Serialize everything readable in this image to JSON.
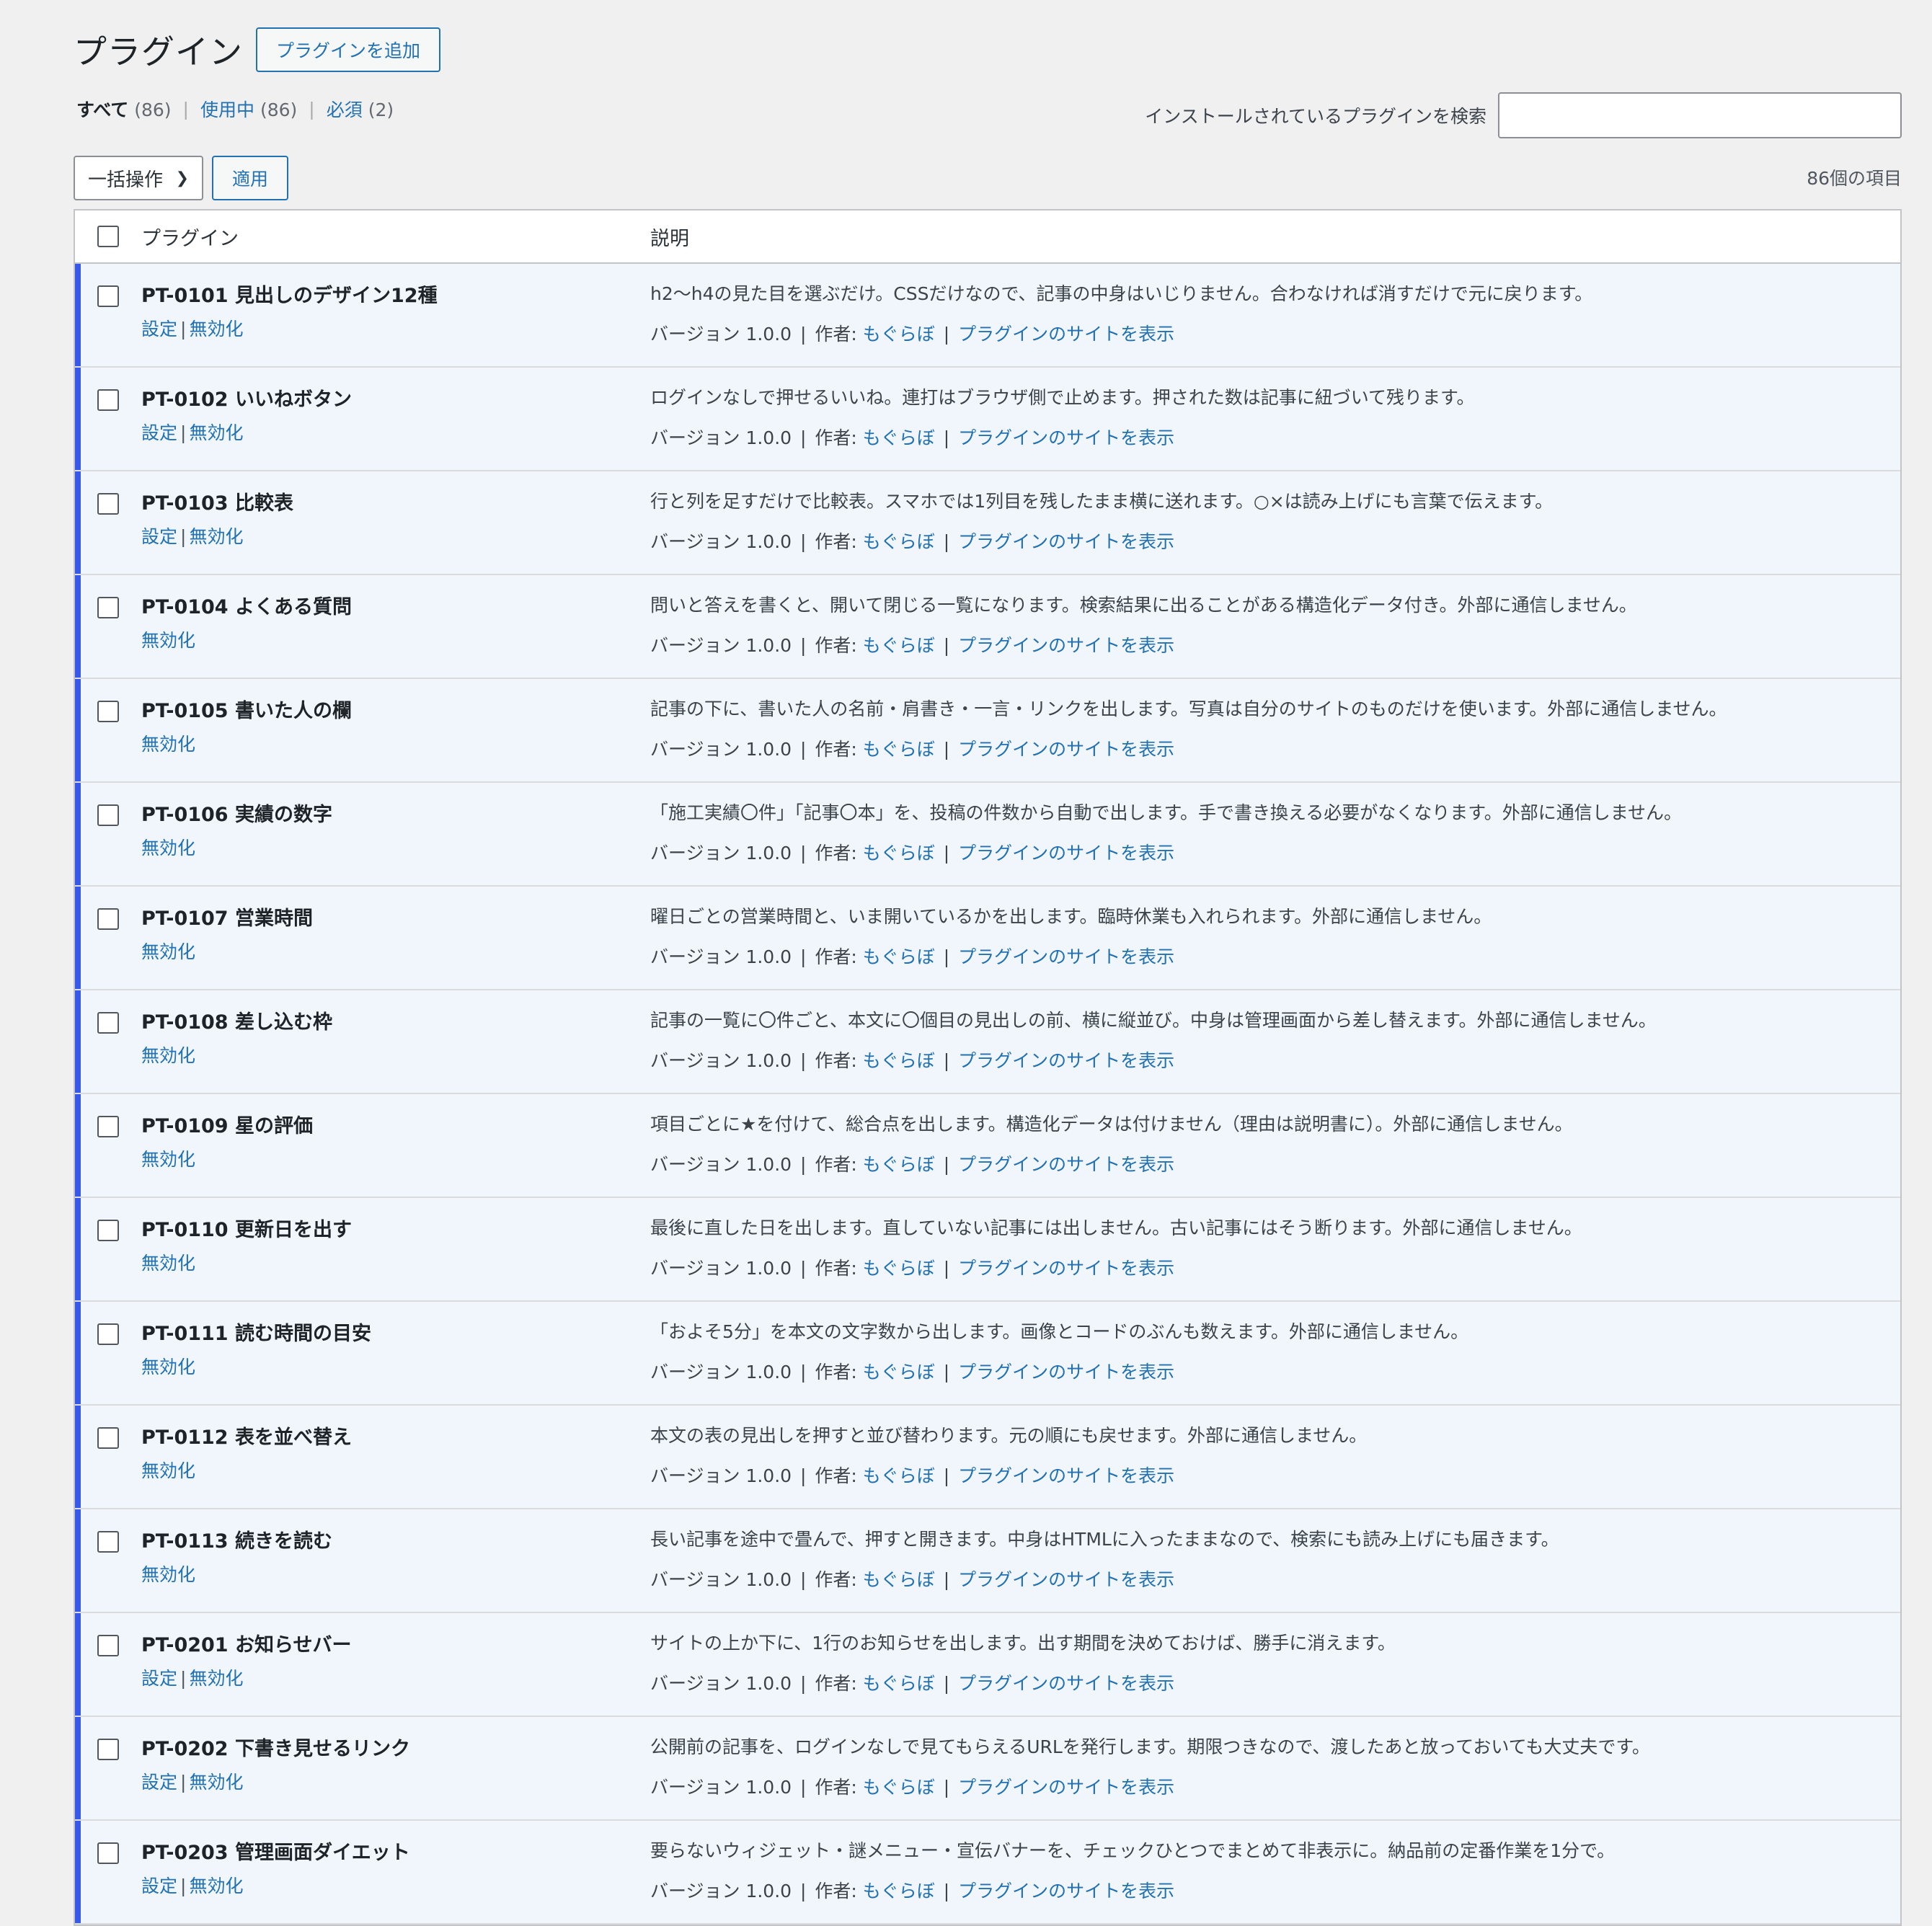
{
  "header": {
    "title": "プラグイン",
    "add_button": "プラグインを追加"
  },
  "filters": {
    "all_label": "すべて",
    "all_count": "(86)",
    "active_label": "使用中",
    "active_count": "(86)",
    "required_label": "必須",
    "required_count": "(2)",
    "separator": "|"
  },
  "search": {
    "label": "インストールされているプラグインを検索",
    "value": "",
    "placeholder": ""
  },
  "tablenav": {
    "bulk_action": "一括操作",
    "apply_button": "適用",
    "items_count": "86個の項目"
  },
  "table": {
    "headers": {
      "plugin": "プラグイン",
      "description": "説明"
    },
    "meta": {
      "version_label": "バージョン 1.0.0",
      "author_prefix": "作者:",
      "author_name": "もぐらぼ",
      "site_link": "プラグインのサイトを表示",
      "separator": "|"
    },
    "actions": {
      "settings": "設定",
      "deactivate": "無効化",
      "separator": "|"
    },
    "rows": [
      {
        "name": "PT-0101 見出しのデザイン12種",
        "has_settings": true,
        "description": "h2〜h4の見た目を選ぶだけ。CSSだけなので、記事の中身はいじりません。合わなければ消すだけで元に戻ります。"
      },
      {
        "name": "PT-0102 いいねボタン",
        "has_settings": true,
        "description": "ログインなしで押せるいいね。連打はブラウザ側で止めます。押された数は記事に紐づいて残ります。"
      },
      {
        "name": "PT-0103 比較表",
        "has_settings": true,
        "description": "行と列を足すだけで比較表。スマホでは1列目を残したまま横に送れます。○×は読み上げにも言葉で伝えます。"
      },
      {
        "name": "PT-0104 よくある質問",
        "has_settings": false,
        "description": "問いと答えを書くと、開いて閉じる一覧になります。検索結果に出ることがある構造化データ付き。外部に通信しません。"
      },
      {
        "name": "PT-0105 書いた人の欄",
        "has_settings": false,
        "description": "記事の下に、書いた人の名前・肩書き・一言・リンクを出します。写真は自分のサイトのものだけを使います。外部に通信しません。"
      },
      {
        "name": "PT-0106 実績の数字",
        "has_settings": false,
        "description": "「施工実績〇件」「記事〇本」を、投稿の件数から自動で出します。手で書き換える必要がなくなります。外部に通信しません。"
      },
      {
        "name": "PT-0107 営業時間",
        "has_settings": false,
        "description": "曜日ごとの営業時間と、いま開いているかを出します。臨時休業も入れられます。外部に通信しません。"
      },
      {
        "name": "PT-0108 差し込む枠",
        "has_settings": false,
        "description": "記事の一覧に〇件ごと、本文に〇個目の見出しの前、横に縦並び。中身は管理画面から差し替えます。外部に通信しません。"
      },
      {
        "name": "PT-0109 星の評価",
        "has_settings": false,
        "description": "項目ごとに★を付けて、総合点を出します。構造化データは付けません（理由は説明書に）。外部に通信しません。"
      },
      {
        "name": "PT-0110 更新日を出す",
        "has_settings": false,
        "description": "最後に直した日を出します。直していない記事には出しません。古い記事にはそう断ります。外部に通信しません。"
      },
      {
        "name": "PT-0111 読む時間の目安",
        "has_settings": false,
        "description": "「およそ5分」を本文の文字数から出します。画像とコードのぶんも数えます。外部に通信しません。"
      },
      {
        "name": "PT-0112 表を並べ替え",
        "has_settings": false,
        "description": "本文の表の見出しを押すと並び替わります。元の順にも戻せます。外部に通信しません。"
      },
      {
        "name": "PT-0113 続きを読む",
        "has_settings": false,
        "description": "長い記事を途中で畳んで、押すと開きます。中身はHTMLに入ったままなので、検索にも読み上げにも届きます。"
      },
      {
        "name": "PT-0201 お知らせバー",
        "has_settings": true,
        "description": "サイトの上か下に、1行のお知らせを出します。出す期間を決めておけば、勝手に消えます。"
      },
      {
        "name": "PT-0202 下書き見せるリンク",
        "has_settings": true,
        "description": "公開前の記事を、ログインなしで見てもらえるURLを発行します。期限つきなので、渡したあと放っておいても大丈夫です。"
      },
      {
        "name": "PT-0203 管理画面ダイエット",
        "has_settings": true,
        "description": "要らないウィジェット・謎メニュー・宣伝バナーを、チェックひとつでまとめて非表示に。納品前の定番作業を1分で。"
      }
    ]
  },
  "colors": {
    "accent": "#2271b1",
    "active_row_bg": "#f0f6fc",
    "active_border": "#3858e9",
    "page_bg": "#f0f0f1"
  }
}
